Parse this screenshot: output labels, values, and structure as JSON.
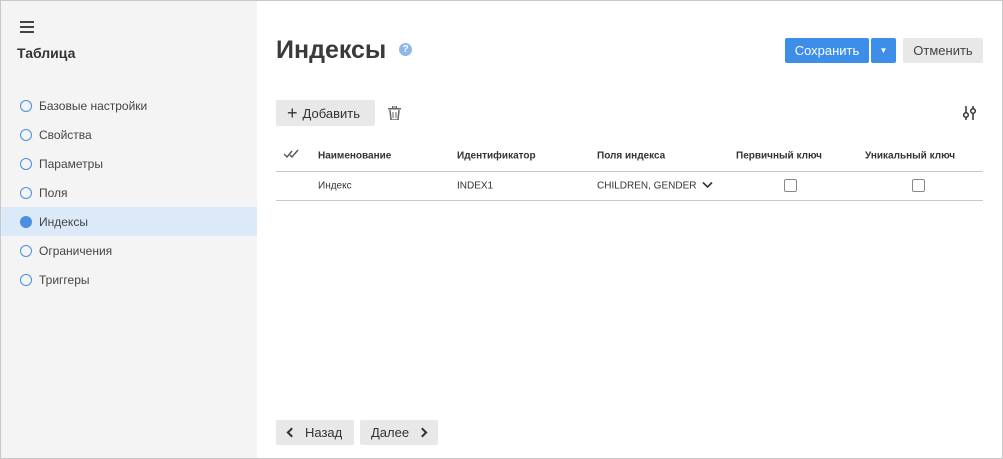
{
  "sidebar": {
    "title": "Таблица",
    "items": [
      {
        "label": "Базовые настройки",
        "active": false
      },
      {
        "label": "Свойства",
        "active": false
      },
      {
        "label": "Параметры",
        "active": false
      },
      {
        "label": "Поля",
        "active": false
      },
      {
        "label": "Индексы",
        "active": true
      },
      {
        "label": "Ограничения",
        "active": false
      },
      {
        "label": "Триггеры",
        "active": false
      }
    ]
  },
  "header": {
    "title": "Индексы",
    "help_glyph": "?",
    "save_label": "Сохранить",
    "save_dropdown_glyph": "▼",
    "cancel_label": "Отменить"
  },
  "toolbar": {
    "add_label": "Добавить",
    "add_glyph": "+"
  },
  "table": {
    "columns": [
      "Наименование",
      "Идентификатор",
      "Поля индекса",
      "Первичный ключ",
      "Уникальный ключ"
    ],
    "rows": [
      {
        "name": "Индекс",
        "identifier": "INDEX1",
        "fields": "CHILDREN, GENDER",
        "primary": false,
        "unique": false
      }
    ]
  },
  "footer": {
    "back_label": "Назад",
    "next_label": "Далее"
  },
  "colors": {
    "accent": "#3d8ee8",
    "sidebar_bg": "#f4f4f4",
    "active_item_bg": "#dce9f9"
  }
}
